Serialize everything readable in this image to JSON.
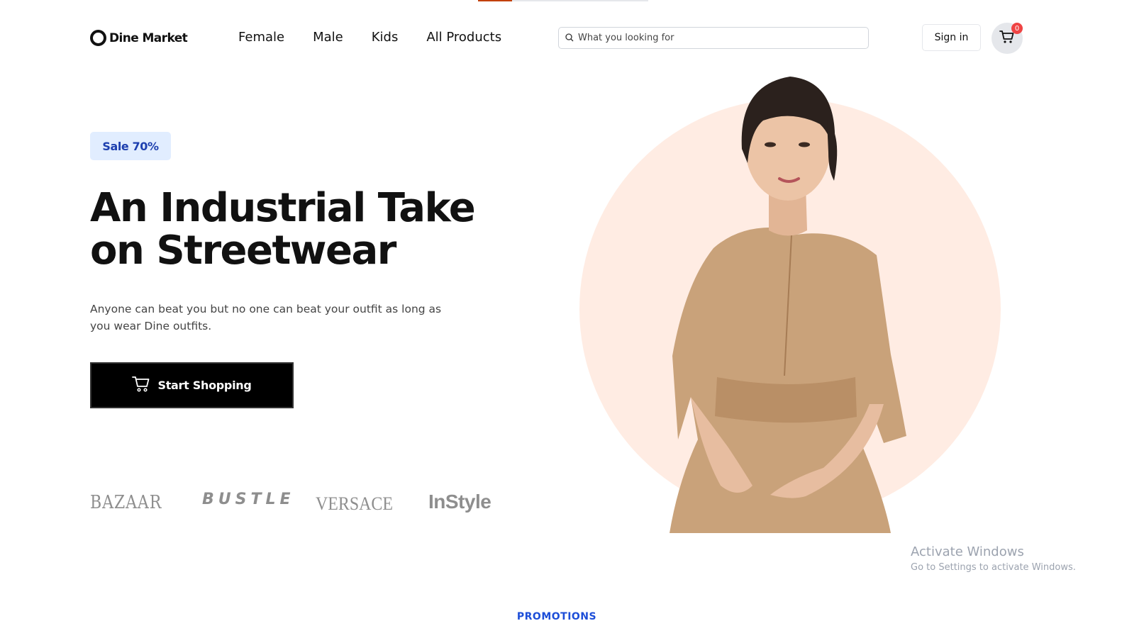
{
  "loading": {
    "progress": 0.2,
    "color": "#c2410c"
  },
  "header": {
    "logo_text": "Dine Market",
    "nav": [
      "Female",
      "Male",
      "Kids",
      "All Products"
    ],
    "search_placeholder": "What you looking for",
    "signin_label": "Sign in",
    "cart_count": "0"
  },
  "hero": {
    "badge": "Sale 70%",
    "headline": "An Industrial Take on Streetwear",
    "subtext": "Anyone can beat you but no one can beat your outfit as long as you wear Dine outfits.",
    "cta_label": "Start Shopping",
    "brands": [
      "BAZAAR",
      "BUSTLE",
      "VERSACE",
      "InStyle"
    ],
    "circle_color": "#ffece3"
  },
  "watermark": {
    "title": "Activate Windows",
    "subtitle": "Go to Settings to activate Windows."
  },
  "section_label": "PROMOTIONS",
  "colors": {
    "accent": "#1d4ed8",
    "badge_bg": "#e1edff",
    "cta_bg": "#000000"
  },
  "icons": [
    "search-icon",
    "cart-icon",
    "logo-ring-icon"
  ]
}
